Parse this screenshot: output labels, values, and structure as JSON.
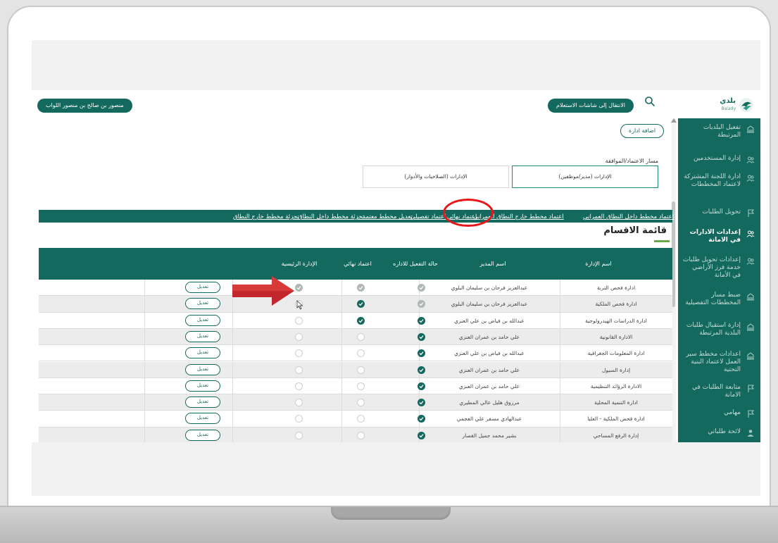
{
  "header": {
    "user_name": "منصور بن صالح بن منصور اللواب",
    "switch_label": "الانتقال إلى شاشات الاستعلام",
    "logo_text": "بلدي",
    "logo_sub": "Balady"
  },
  "sidebar": {
    "items": [
      {
        "label": "تفعيل البلديات المرتبطة",
        "icon": "building-icon",
        "active": false
      },
      {
        "label": "إدارة المستخدمين",
        "icon": "users-icon",
        "active": false
      },
      {
        "label": "ادارة اللجنة المشتركة لاعتماد المخططات",
        "icon": "users-icon",
        "active": false
      },
      {
        "label": "تحويل الطلبات",
        "icon": "flag-icon",
        "active": false
      },
      {
        "label": "إعدادات الادارات في الامانة",
        "icon": "users-icon",
        "active": true
      },
      {
        "label": "إعدادات تحويل طلبات خدمة فرز الأراضي في الأمانة",
        "icon": "users-icon",
        "active": false
      },
      {
        "label": "ضبط مسار المخططات التفصيلية",
        "icon": "building-icon",
        "active": false
      },
      {
        "label": "إدارة استقبال طلبات البلدية المرتبطة",
        "icon": "building-icon",
        "active": false
      },
      {
        "label": "اعدادات مخطط سير العمل لاعتماد البنية التحتية",
        "icon": "building-icon",
        "active": false
      },
      {
        "label": "متابعة الطلبات في الامانة",
        "icon": "flag-icon",
        "active": false
      },
      {
        "label": "مهامي",
        "icon": "flag-icon",
        "active": false
      },
      {
        "label": "لائحة طلباتي",
        "icon": "user-icon",
        "active": false
      }
    ]
  },
  "content": {
    "add_button": "اضافة ادارة",
    "path_label": "مسار الاعتماد/الموافقة",
    "radio_right": "الإدارات (مدير/موظفين)",
    "radio_left": "الإدارات (الصلاحيات والأدوار)",
    "tabs": [
      "اعتماد مخطط داخل النطاق العمراني",
      "اعتماد مخطط خارج النطاق العمراني",
      "اعتماد نهائي",
      "اعتماد تفصيلي",
      "تعديل مخطط معتمد",
      "تجزئة مخطط داخل النطاق",
      "تجزئة مخطط خارج النطاق"
    ],
    "section_title": "قائمة الاقسام"
  },
  "table": {
    "headers": {
      "dept": "اسم الإدارة",
      "manager": "اسم المدير",
      "status": "حالة التفعيل للاداره",
      "final": "اعتماد نهائي",
      "main": "الإدارة الرئيسية"
    },
    "edit_label": "تعديل",
    "rows": [
      {
        "dept": "ادارة فحص التربة",
        "manager": "عبدالعزيز فرحان بن سليمان البلوي",
        "status": "gray",
        "final": "gray",
        "main": "gray"
      },
      {
        "dept": "ادارة فحص الملكية",
        "manager": "عبدالعزيز فرحان بن سليمان البلوي",
        "status": "gray",
        "final": "on",
        "main": "off"
      },
      {
        "dept": "ادارة الدراسات الهيدرولوجية",
        "manager": "عبدالله بن فياض بن علي العنزي",
        "status": "on",
        "final": "on",
        "main": "off"
      },
      {
        "dept": "الادارة القانونية",
        "manager": "علي حامد بن عمران العنزي",
        "status": "on",
        "final": "off",
        "main": "off"
      },
      {
        "dept": "ادارة المعلومات الجغرافية",
        "manager": "عبدالله بن فياض بن علي العنزي",
        "status": "on",
        "final": "off",
        "main": "off"
      },
      {
        "dept": "إدارة السيول",
        "manager": "علي حامد بن عمران العنزي",
        "status": "on",
        "final": "off",
        "main": "off"
      },
      {
        "dept": "الادارة الرؤائد التنظيمية",
        "manager": "علي حامد بن عمران العنزي",
        "status": "on",
        "final": "off",
        "main": "off"
      },
      {
        "dept": "ادارة التنمية المحلية",
        "manager": "مرزوق هليل عالي المطيري",
        "status": "on",
        "final": "off",
        "main": "off"
      },
      {
        "dept": "ادارة فحص الملكية - العليا",
        "manager": "عبدالهادي مسفر علي العجمي",
        "status": "on",
        "final": "off",
        "main": "off"
      },
      {
        "dept": "إدارة الرفع المساحي",
        "manager": "بشير محمد جميل القصار",
        "status": "on",
        "final": "off",
        "main": "off"
      }
    ]
  },
  "colors": {
    "brand": "#14695e",
    "accent_underline": "#6aa94a",
    "annotation": "#e8151b"
  }
}
